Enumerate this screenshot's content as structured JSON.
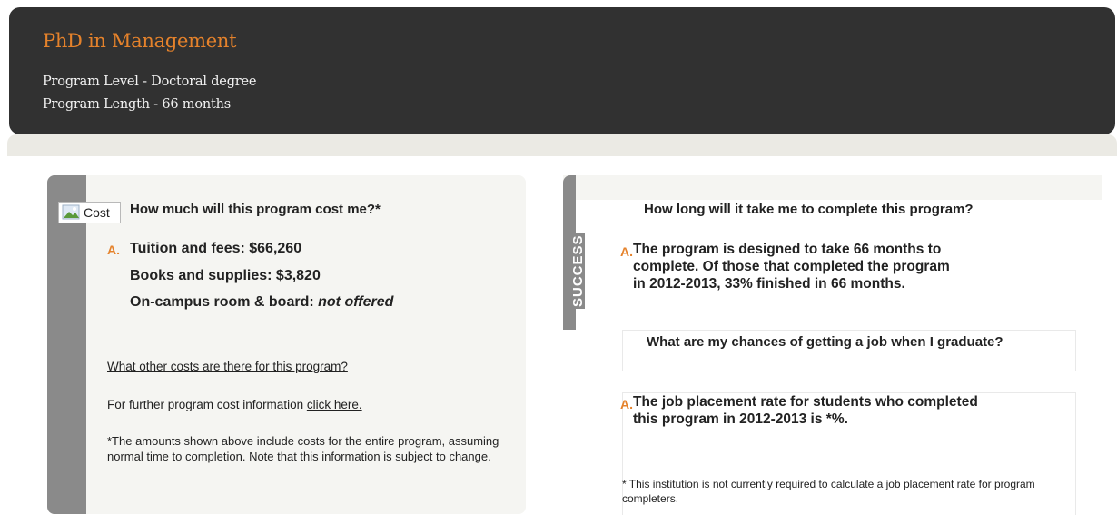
{
  "header": {
    "title": "PhD in Management",
    "level": "Program Level - Doctoral degree",
    "length": "Program Length - 66 months"
  },
  "cost": {
    "image_alt": "Cost",
    "question": "How much will this program cost me?*",
    "answer_letter": "A.",
    "tuition": "Tuition and fees: $66,260",
    "books": "Books and supplies: $3,820",
    "room_label": "On-campus room & board: ",
    "room_value": "not offered",
    "other_costs_link": "What other costs are there for this program?",
    "further_text": "For further program cost information ",
    "further_link": "click here.",
    "note": "*The amounts shown above include costs for the entire program, assuming normal time to completion. Note that this information is subject to change."
  },
  "success": {
    "label": "SUCCESS",
    "q1": "How long will it take me to complete this program?",
    "a1_letter": "A.",
    "a1_line1": "The program is designed to take 66 months to",
    "a1_line2": "complete. Of those that completed the program",
    "a1_line3": "in 2012-2013, 33% finished in 66 months.",
    "q2": "What are my chances of getting a job when I graduate?",
    "a2_letter": "A.",
    "a2_line1": "The job placement rate for students who completed",
    "a2_line2": "this program in 2012-2013 is *%.",
    "note": "* This institution is not currently required to calculate a job placement rate for program completers."
  },
  "colors": {
    "header_bg": "#313131",
    "accent": "#e5822b",
    "panel_bg": "#f5f5f2",
    "strip": "#8a8a8a"
  }
}
